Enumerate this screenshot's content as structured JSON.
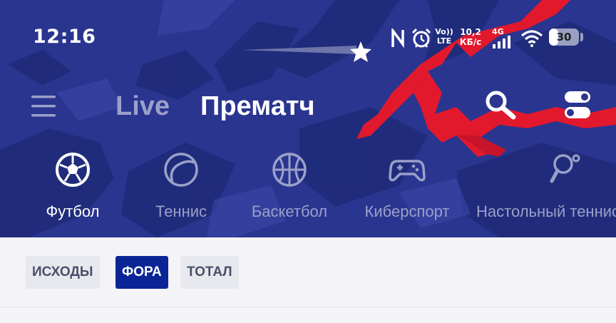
{
  "status_bar": {
    "time": "12:16",
    "volte_top": "Vo))",
    "volte_bottom": "LTE",
    "net_speed_top": "10,2",
    "net_speed_bottom": "КБ/с",
    "network_type": "4G",
    "battery_level": "30",
    "battery_fraction": 0.3
  },
  "nav": {
    "tabs": [
      {
        "label": "Live",
        "active": false
      },
      {
        "label": "Прематч",
        "active": true
      }
    ]
  },
  "sports": [
    {
      "label": "Футбол",
      "icon": "soccer-ball-icon",
      "active": true
    },
    {
      "label": "Теннис",
      "icon": "tennis-ball-icon",
      "active": false
    },
    {
      "label": "Баскетбол",
      "icon": "basketball-icon",
      "active": false
    },
    {
      "label": "Киберспорт",
      "icon": "gamepad-icon",
      "active": false
    },
    {
      "label": "Настольный теннис",
      "icon": "table-tennis-icon",
      "active": false
    }
  ],
  "filters": [
    {
      "label": "ИСХОДЫ",
      "active": false
    },
    {
      "label": "ФОРА",
      "active": true
    },
    {
      "label": "ТОТАЛ",
      "active": false
    }
  ],
  "colors": {
    "header_bg": "#2a3590",
    "accent_red": "#e2192c",
    "chip_active": "#0b2596",
    "inactive_text": "#9aa0c8"
  }
}
